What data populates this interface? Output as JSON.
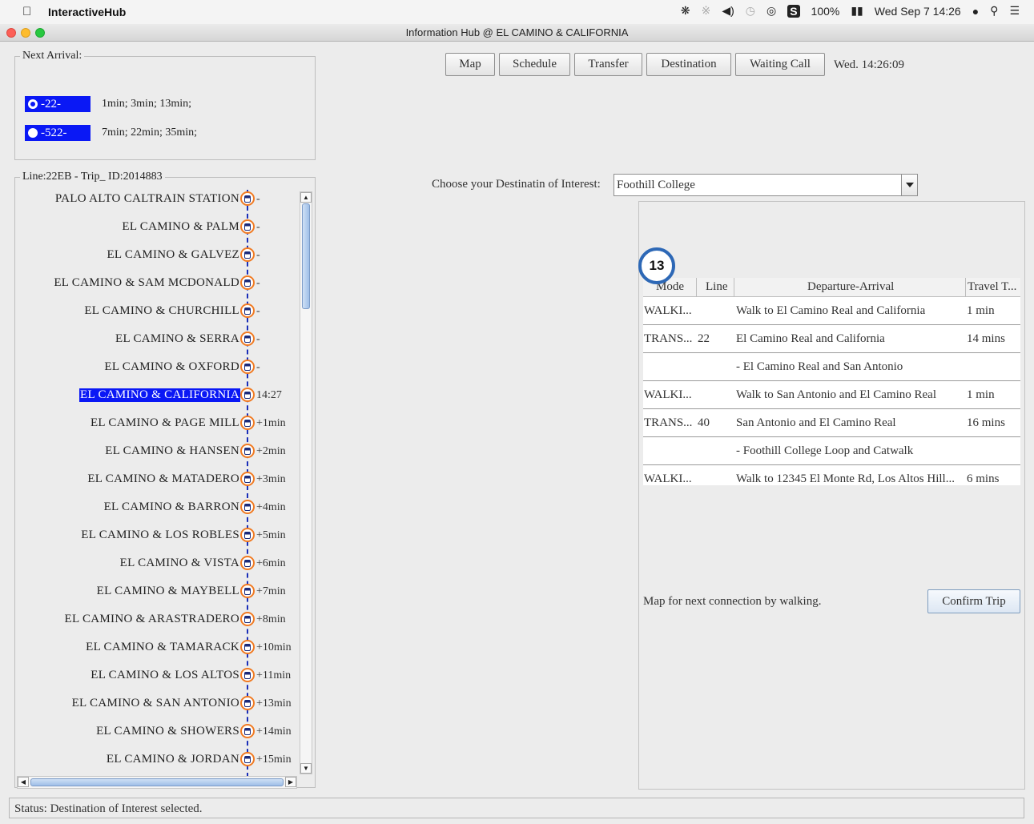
{
  "menubar": {
    "app_name": "InteractiveHub",
    "battery": "100%",
    "datetime": "Wed Sep 7  14:26",
    "icons": [
      "apple-icon",
      "dropbox-icon",
      "bluetooth-icon",
      "volume-icon",
      "time-machine-icon",
      "wifi-icon",
      "s-app-icon",
      "battery-icon",
      "user-icon",
      "spotlight-icon",
      "menu-list-icon"
    ]
  },
  "window": {
    "title": "Information Hub @ EL CAMINO & CALIFORNIA"
  },
  "next_arrival": {
    "legend": "Next Arrival:",
    "routes": [
      {
        "label": "-22-",
        "times": "1min; 3min; 13min;",
        "selected": true
      },
      {
        "label": "-522-",
        "times": "7min; 22min; 35min;",
        "selected": false
      }
    ]
  },
  "trip_line": {
    "legend": "Line:22EB - Trip_ ID:2014883",
    "stops": [
      {
        "name": "PALO ALTO CALTRAIN STATION",
        "time": "-",
        "selected": false
      },
      {
        "name": "EL CAMINO & PALM",
        "time": "-",
        "selected": false
      },
      {
        "name": "EL CAMINO & GALVEZ",
        "time": "-",
        "selected": false
      },
      {
        "name": "EL CAMINO & SAM MCDONALD",
        "time": "-",
        "selected": false
      },
      {
        "name": "EL CAMINO & CHURCHILL",
        "time": "-",
        "selected": false
      },
      {
        "name": "EL CAMINO & SERRA",
        "time": "-",
        "selected": false
      },
      {
        "name": "EL CAMINO & OXFORD",
        "time": "-",
        "selected": false
      },
      {
        "name": "EL CAMINO & CALIFORNIA",
        "time": "14:27",
        "selected": true
      },
      {
        "name": "EL CAMINO & PAGE MILL",
        "time": "+1min",
        "selected": false
      },
      {
        "name": "EL CAMINO & HANSEN",
        "time": "+2min",
        "selected": false
      },
      {
        "name": "EL CAMINO & MATADERO",
        "time": "+3min",
        "selected": false
      },
      {
        "name": "EL CAMINO & BARRON",
        "time": "+4min",
        "selected": false
      },
      {
        "name": "EL CAMINO & LOS ROBLES",
        "time": "+5min",
        "selected": false
      },
      {
        "name": "EL CAMINO & VISTA",
        "time": "+6min",
        "selected": false
      },
      {
        "name": "EL CAMINO & MAYBELL",
        "time": "+7min",
        "selected": false
      },
      {
        "name": "EL CAMINO & ARASTRADERO",
        "time": "+8min",
        "selected": false
      },
      {
        "name": "EL CAMINO & TAMARACK",
        "time": "+10min",
        "selected": false
      },
      {
        "name": "EL CAMINO & LOS ALTOS",
        "time": "+11min",
        "selected": false
      },
      {
        "name": "EL CAMINO & SAN ANTONIO",
        "time": "+13min",
        "selected": false
      },
      {
        "name": "EL CAMINO & SHOWERS",
        "time": "+14min",
        "selected": false
      },
      {
        "name": "EL CAMINO & JORDAN",
        "time": "+15min",
        "selected": false
      }
    ]
  },
  "toolbar": {
    "buttons": [
      "Map",
      "Schedule",
      "Transfer",
      "Destination",
      "Waiting Call"
    ],
    "clock": "Wed. 14:26:09"
  },
  "destination": {
    "label": "Choose your Destinatin of Interest:",
    "selected": "Foothill College"
  },
  "trip_table": {
    "badge": "13",
    "headers": [
      "Mode",
      "Line",
      "Departure-Arrival",
      "Travel T..."
    ],
    "rows": [
      {
        "mode": "WALKI...",
        "line": "",
        "dep": "Walk to El Camino Real and California",
        "travel": "1 min"
      },
      {
        "mode": "TRANS...",
        "line": "22",
        "dep": "El Camino Real and California",
        "travel": "14 mins"
      },
      {
        "mode": "",
        "line": "",
        "dep": "- El Camino Real and San Antonio",
        "travel": ""
      },
      {
        "mode": "WALKI...",
        "line": "",
        "dep": "Walk to San Antonio and El Camino Real",
        "travel": "1 min"
      },
      {
        "mode": "TRANS...",
        "line": "40",
        "dep": "San Antonio and El Camino Real",
        "travel": "16 mins"
      },
      {
        "mode": "",
        "line": "",
        "dep": "- Foothill College Loop and Catwalk",
        "travel": ""
      },
      {
        "mode": "WALKI...",
        "line": "",
        "dep": "Walk to 12345 El Monte Rd, Los Altos Hill...",
        "travel": "6 mins"
      }
    ],
    "note": "Map for next connection by walking.",
    "confirm": "Confirm Trip"
  },
  "status": {
    "text": "Status: Destination of Interest selected."
  }
}
